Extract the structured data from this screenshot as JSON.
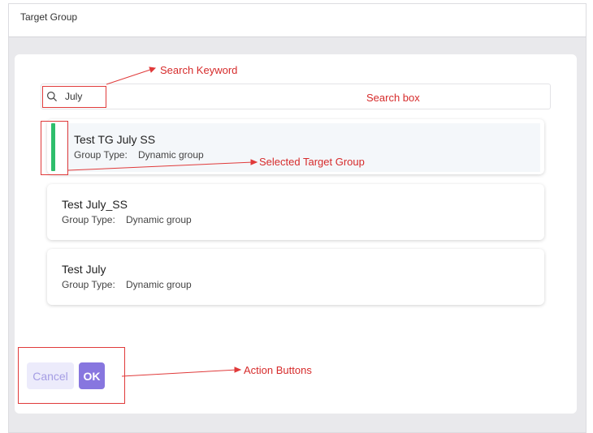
{
  "header": {
    "title": "Target Group"
  },
  "search": {
    "value": "July",
    "icon": "search-icon"
  },
  "results": [
    {
      "title": "Test TG July SS",
      "group_type_label": "Group Type:",
      "group_type": "Dynamic group",
      "selected": true
    },
    {
      "title": "Test July_SS",
      "group_type_label": "Group Type:",
      "group_type": "Dynamic group",
      "selected": false
    },
    {
      "title": "Test July",
      "group_type_label": "Group Type:",
      "group_type": "Dynamic group",
      "selected": false
    }
  ],
  "actions": {
    "cancel": "Cancel",
    "ok": "OK"
  },
  "annotations": {
    "search_keyword": "Search Keyword",
    "search_box": "Search box",
    "selected_target_group": "Selected Target Group",
    "action_buttons": "Action Buttons"
  },
  "colors": {
    "annotation": "#e03a3a",
    "selected_indicator": "#2ebd6b",
    "ok_button": "#8776df",
    "cancel_button_bg": "#ecebfb"
  }
}
